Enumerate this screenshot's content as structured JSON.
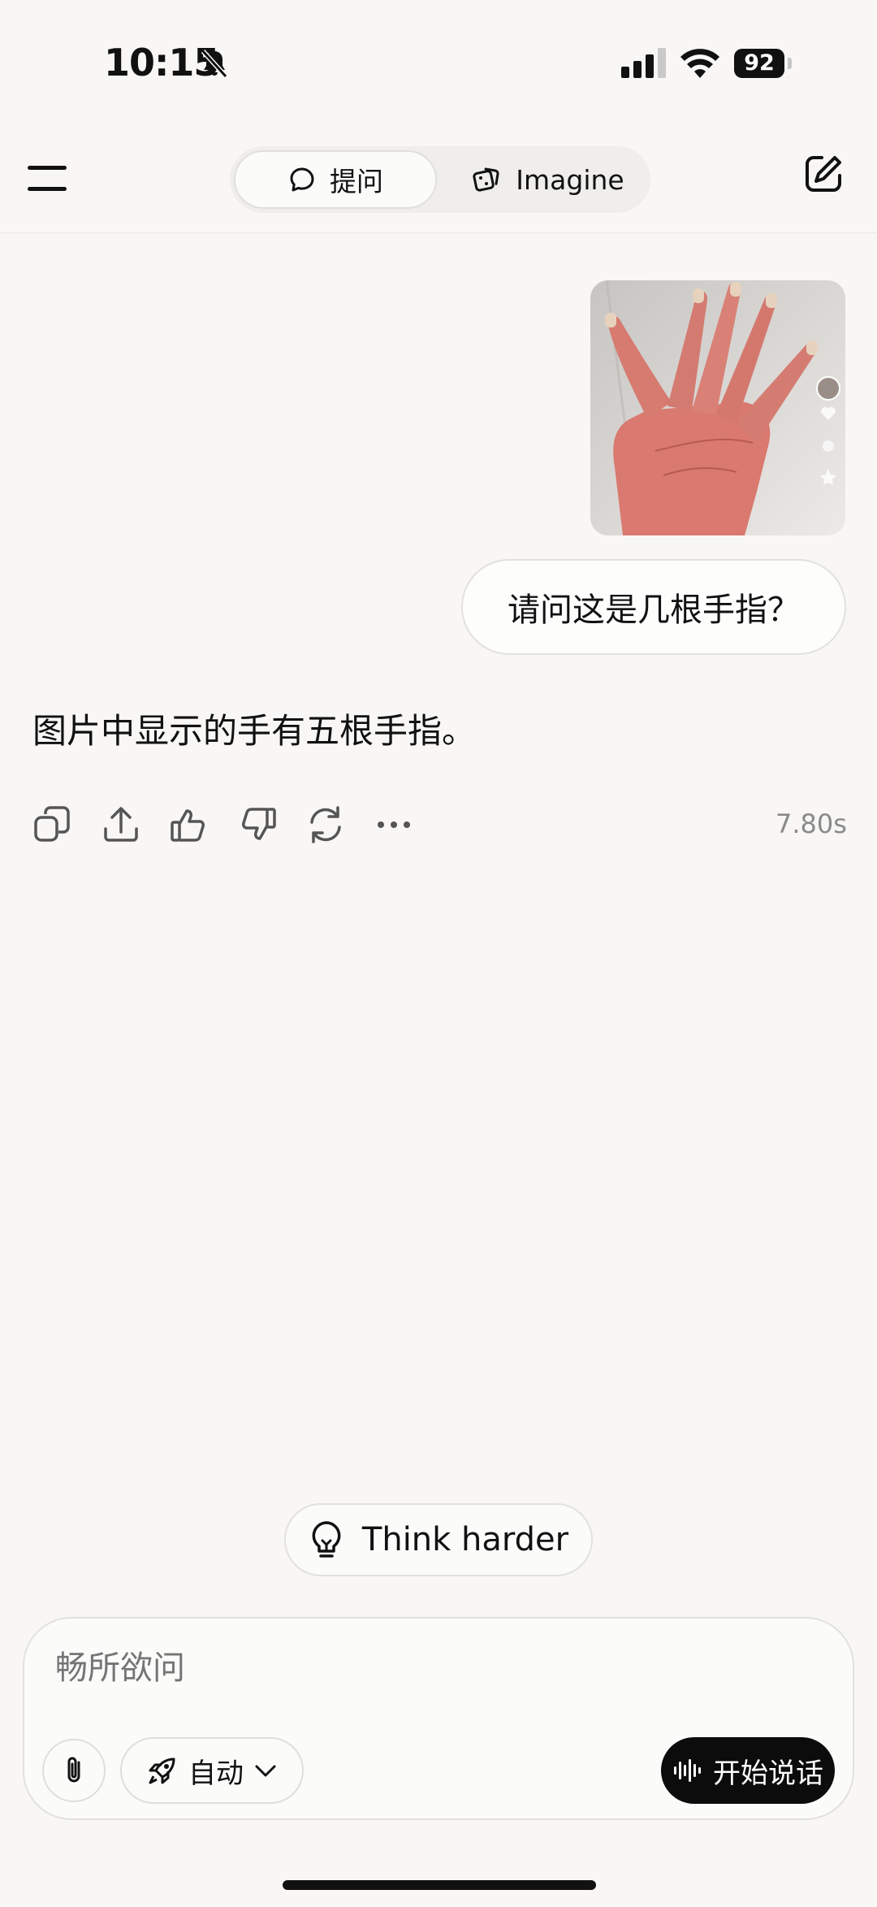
{
  "status_bar": {
    "time": "10:15",
    "battery": "92"
  },
  "header": {
    "tabs": [
      {
        "label": "提问",
        "icon": "chat-bubble-icon",
        "selected": true
      },
      {
        "label": "Imagine",
        "icon": "dice-icon",
        "selected": false
      }
    ]
  },
  "conversation": {
    "user_image_icon": "hand-photo",
    "user_message": "请问这是几根手指？",
    "assistant_message": "图片中显示的手有五根手指。",
    "response_time": "7.80s",
    "actions": [
      "copy-icon",
      "share-icon",
      "thumbs-up-icon",
      "thumbs-down-icon",
      "regenerate-icon",
      "more-icon"
    ]
  },
  "suggestion": {
    "label": "Think harder",
    "icon": "lightbulb-icon"
  },
  "composer": {
    "placeholder": "畅所欲问",
    "model_label": "自动",
    "voice_label": "开始说话"
  }
}
